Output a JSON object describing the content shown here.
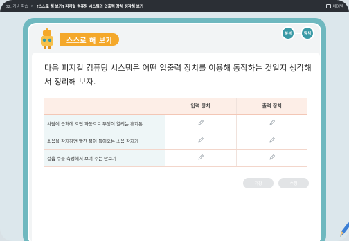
{
  "topbar": {
    "crumb": "02. 개념 학습",
    "separator": ">",
    "title": "[스스로 해 보기] 피지털 컴퓨팅 시스템의 입출력 장치 생각해 보기",
    "right_label": "메이템"
  },
  "header": {
    "badge": "스스로 해 보기",
    "tags": [
      "분석",
      "탐색"
    ]
  },
  "question": "다음 피지컬 컴퓨팅 시스템은 어떤 입출력 장치를 이용해 동작하는 것일지 생각해 서 정리해 보자.",
  "table": {
    "headers": [
      "",
      "입력 장치",
      "출력 장치"
    ],
    "rows": [
      {
        "label": "사람이 근처에 오면 자동으로 뚜껑이 열리는 휴지통"
      },
      {
        "label": "소음을 감지하면 빨간 불이 들어오는 소음 감지기"
      },
      {
        "label": "걸음 수를 측정해서 보여 주는 만보기"
      }
    ]
  },
  "buttons": {
    "save": "저장",
    "edit": "수정"
  },
  "colors": {
    "accent": "#f4a82b",
    "board": "#6fb8bf",
    "tag": "#3a9aa6"
  }
}
